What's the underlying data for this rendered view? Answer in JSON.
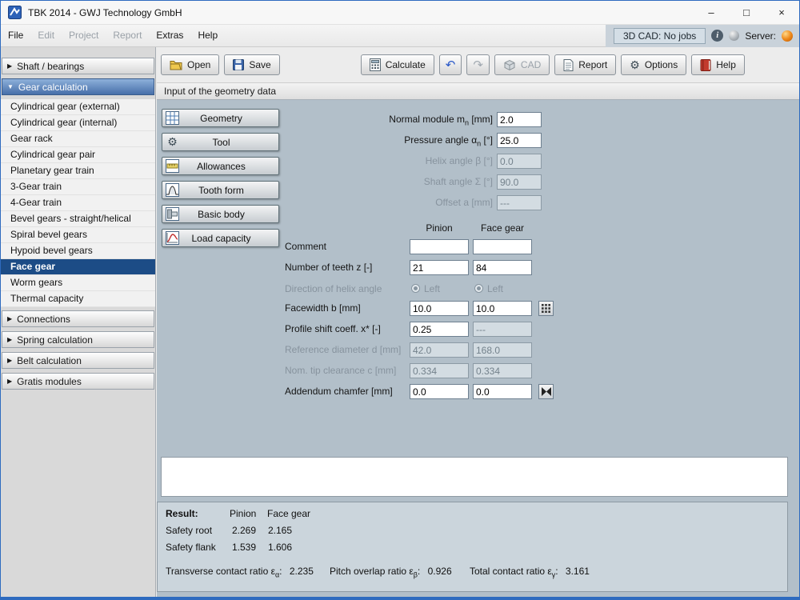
{
  "window": {
    "title": "TBK 2014 - GWJ Technology GmbH",
    "controls": {
      "minimize": "–",
      "maximize": "□",
      "close": "×"
    }
  },
  "menubar": {
    "items": [
      {
        "label": "File",
        "enabled": true
      },
      {
        "label": "Edit",
        "enabled": false
      },
      {
        "label": "Project",
        "enabled": false
      },
      {
        "label": "Report",
        "enabled": false
      },
      {
        "label": "Extras",
        "enabled": true
      },
      {
        "label": "Help",
        "enabled": true
      }
    ],
    "cad_status": "3D CAD: No jobs",
    "info_glyph": "i",
    "server_label": "Server:"
  },
  "toolbar": {
    "open": "Open",
    "save": "Save",
    "calculate": "Calculate",
    "undo_glyph": "↶",
    "redo_glyph": "↷",
    "cad": "CAD",
    "report": "Report",
    "options": "Options",
    "help": "Help"
  },
  "icons": {
    "collapsed": "▶",
    "expanded": "▼",
    "gear": "⚙"
  },
  "sidebar": {
    "sections": [
      {
        "label": "Shaft / bearings",
        "expanded": false
      },
      {
        "label": "Gear calculation",
        "expanded": true
      },
      {
        "label": "Connections",
        "expanded": false
      },
      {
        "label": "Spring calculation",
        "expanded": false
      },
      {
        "label": "Belt calculation",
        "expanded": false
      },
      {
        "label": "Gratis modules",
        "expanded": false
      }
    ],
    "gear_items": [
      {
        "label": "Cylindrical gear (external)"
      },
      {
        "label": "Cylindrical gear (internal)"
      },
      {
        "label": "Gear rack"
      },
      {
        "label": "Cylindrical gear pair"
      },
      {
        "label": "Planetary gear train"
      },
      {
        "label": "3-Gear train"
      },
      {
        "label": "4-Gear train"
      },
      {
        "label": "Bevel gears - straight/helical"
      },
      {
        "label": "Spiral bevel gears"
      },
      {
        "label": "Hypoid bevel gears"
      },
      {
        "label": "Face gear",
        "selected": true
      },
      {
        "label": "Worm gears"
      },
      {
        "label": "Thermal capacity"
      }
    ]
  },
  "form": {
    "section_title": "Input of the geometry data",
    "nav_buttons": [
      {
        "label": "Geometry"
      },
      {
        "label": "Tool"
      },
      {
        "label": "Allowances"
      },
      {
        "label": "Tooth form"
      },
      {
        "label": "Basic body"
      },
      {
        "label": "Load capacity"
      }
    ],
    "single_fields": [
      {
        "label": "Normal module m",
        "sub": "n",
        "unit": " [mm]",
        "value": "2.0",
        "enabled": true
      },
      {
        "label": "Pressure angle α",
        "sub": "n",
        "unit": " [°]",
        "value": "25.0",
        "enabled": true
      },
      {
        "label": "Helix angle β [°]",
        "sub": "",
        "unit": "",
        "value": "0.0",
        "enabled": false
      },
      {
        "label": "Shaft angle Σ [°]",
        "sub": "",
        "unit": "",
        "value": "90.0",
        "enabled": false
      },
      {
        "label": "Offset a [mm]",
        "sub": "",
        "unit": "",
        "value": "---",
        "enabled": false
      }
    ],
    "columns": {
      "pinion": "Pinion",
      "face": "Face gear"
    },
    "pair_fields": [
      {
        "label": "Comment",
        "pinion": "",
        "face": ""
      },
      {
        "label": "Number of teeth z [-]",
        "pinion": "21",
        "face": "84"
      },
      {
        "label": "Direction of helix angle",
        "pinion": "Left",
        "face": "Left",
        "enabled": false
      },
      {
        "label": "Facewidth b [mm]",
        "pinion": "10.0",
        "face": "10.0"
      },
      {
        "label": "Profile shift coeff. x* [-]",
        "pinion": "0.25",
        "face": "---"
      },
      {
        "label": "Reference diameter d [mm]",
        "pinion": "42.0",
        "face": "168.0",
        "enabled": false
      },
      {
        "label": "Nom. tip clearance c [mm]",
        "pinion": "0.334",
        "face": "0.334",
        "enabled": false
      },
      {
        "label": "Addendum chamfer [mm]",
        "pinion": "0.0",
        "face": "0.0"
      }
    ]
  },
  "result": {
    "title": "Result:",
    "col_pinion": "Pinion",
    "col_face": "Face gear",
    "rows": [
      {
        "label": "Safety root",
        "pinion": "2.269",
        "face": "2.165"
      },
      {
        "label": "Safety flank",
        "pinion": "1.539",
        "face": "1.606"
      }
    ],
    "ratios": [
      {
        "label": "Transverse contact ratio ε",
        "sub": "α",
        "suffix": ":",
        "value": "2.235"
      },
      {
        "label": "Pitch overlap ratio ε",
        "sub": "β",
        "suffix": ":",
        "value": "0.926"
      },
      {
        "label": "Total contact ratio ε",
        "sub": "γ",
        "suffix": ":",
        "value": "3.161"
      }
    ]
  }
}
